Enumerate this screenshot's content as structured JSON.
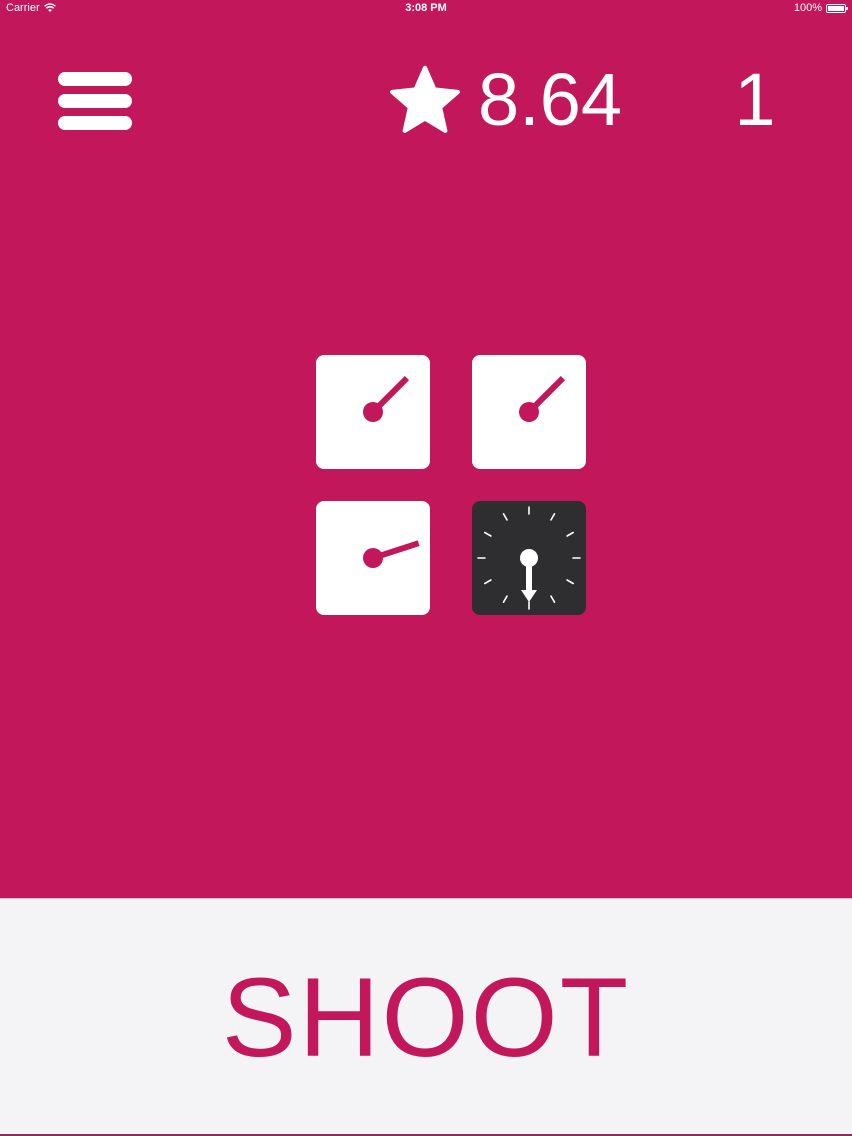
{
  "status_bar": {
    "carrier": "Carrier",
    "time": "3:08 PM",
    "battery": "100%",
    "battery_level": 1.0
  },
  "header": {
    "menu_icon": "hamburger-menu-icon",
    "star_icon": "star-icon",
    "score": "8.64",
    "level": "1"
  },
  "dials": [
    {
      "style": "light",
      "hand_angle_deg": 45
    },
    {
      "style": "light",
      "hand_angle_deg": 45
    },
    {
      "style": "light",
      "hand_angle_deg": 18
    },
    {
      "style": "dark",
      "hand_angle_deg": 270
    }
  ],
  "bottom": {
    "shoot_label": "SHOOT"
  },
  "colors": {
    "background": "#c2185b",
    "accent": "#c2185b",
    "dial_light": "#ffffff",
    "dial_dark": "#2e2d30",
    "panel": "#f4f3f6"
  }
}
